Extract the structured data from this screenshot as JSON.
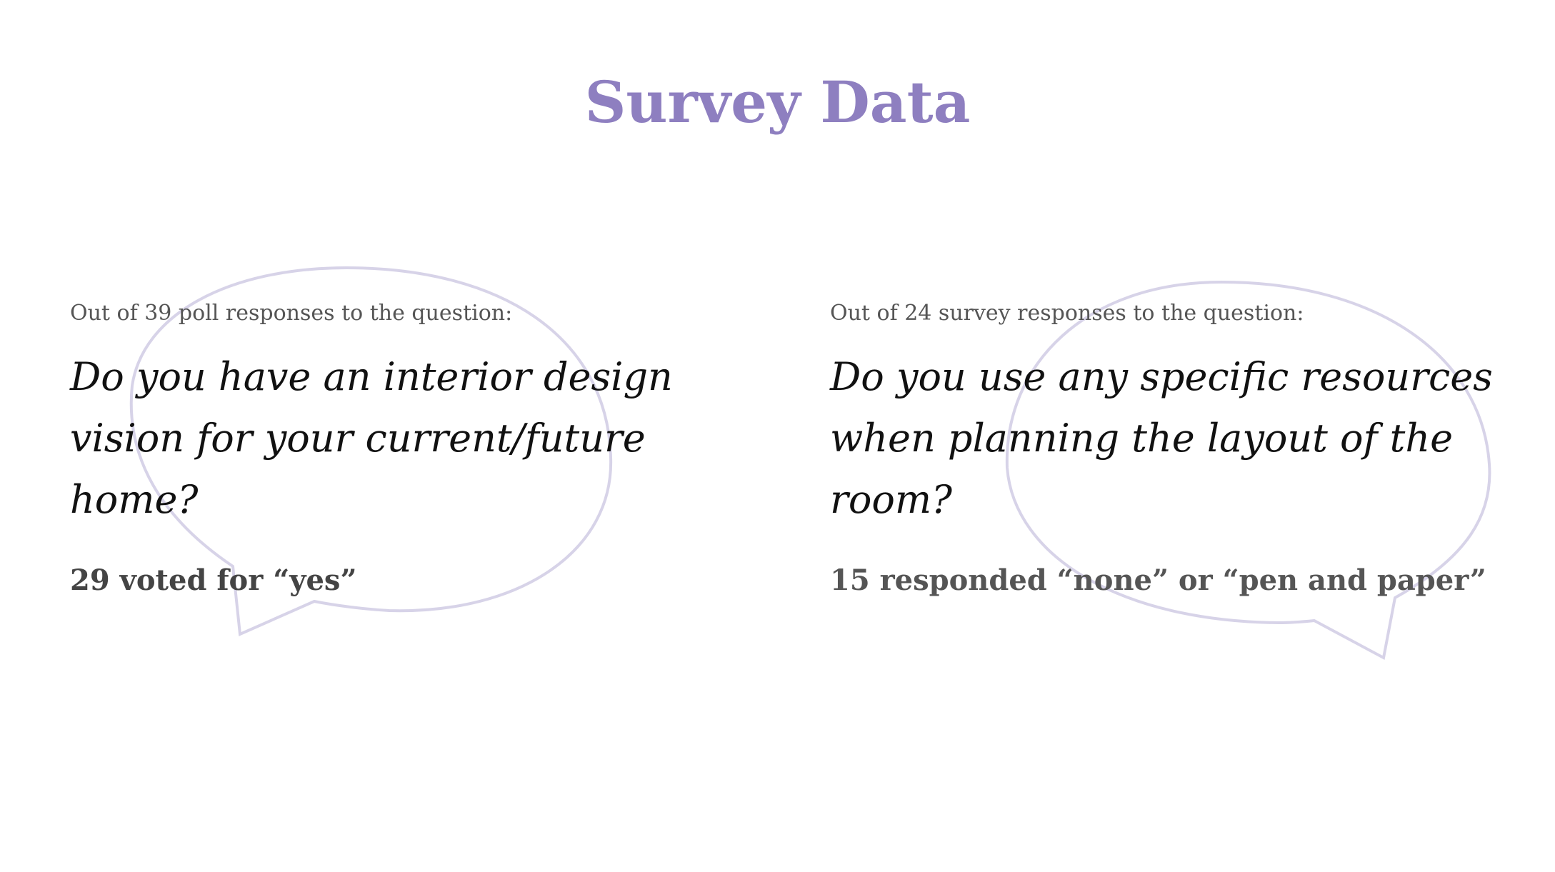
{
  "slide": {
    "title": "Survey Data",
    "accent_color": "#8e7fc0",
    "bubble_color": "#d7d3e8"
  },
  "panels": [
    {
      "intro": "Out of 39 poll responses to the question:",
      "question": "Do you have an interior design vision for your current/future home?",
      "result": "29 voted for “yes”",
      "icon": "speech-bubble-icon"
    },
    {
      "intro": "Out of 24 survey responses to the question:",
      "question": "Do you use any specific resources when planning the layout of the room?",
      "result": "15 responded “none” or “pen and paper”",
      "icon": "speech-bubble-icon"
    }
  ]
}
